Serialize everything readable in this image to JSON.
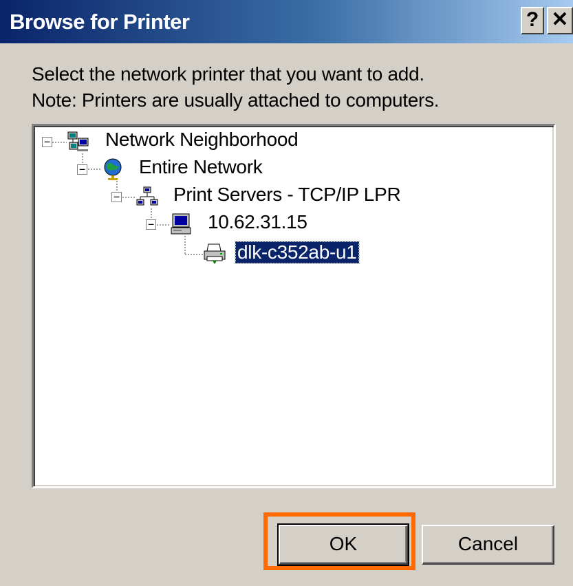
{
  "window": {
    "title": "Browse for Printer",
    "help_label": "?",
    "close_label": "✕"
  },
  "instructions": {
    "line1": "Select the network printer that you want to add.",
    "line2": "Note: Printers are usually attached to computers."
  },
  "tree": {
    "nodes": [
      {
        "label": "Network Neighborhood",
        "icon": "network-neighborhood-icon",
        "expanded": true
      },
      {
        "label": "Entire Network",
        "icon": "globe-icon",
        "expanded": true
      },
      {
        "label": "Print Servers - TCP/IP LPR",
        "icon": "network-icon",
        "expanded": true
      },
      {
        "label": "10.62.31.15",
        "icon": "computer-icon",
        "expanded": true
      },
      {
        "label": "dlk-c352ab-u1",
        "icon": "printer-icon",
        "selected": true
      }
    ]
  },
  "buttons": {
    "ok": "OK",
    "cancel": "Cancel"
  },
  "colors": {
    "title_bar": "#0a246a",
    "highlight": "#ff6a00",
    "selection": "#0a246a"
  }
}
